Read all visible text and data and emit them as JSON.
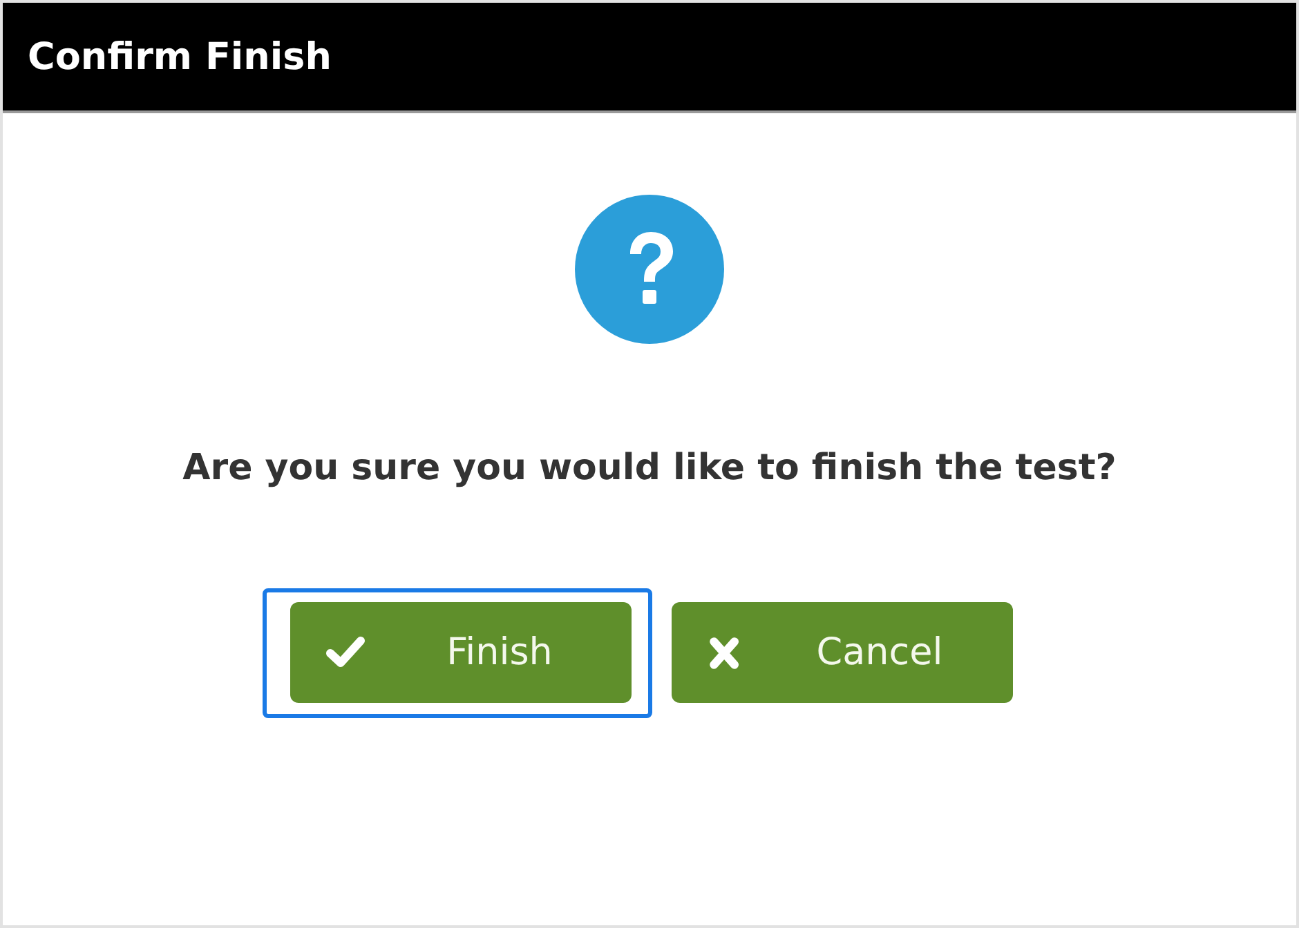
{
  "window": {
    "title": "Confirm Finish"
  },
  "message": "Are you sure you would like to finish the test?",
  "buttons": [
    {
      "label": "Finish",
      "kind": "confirm",
      "focused": true
    },
    {
      "label": "Cancel",
      "kind": "cancel",
      "focused": false
    }
  ]
}
